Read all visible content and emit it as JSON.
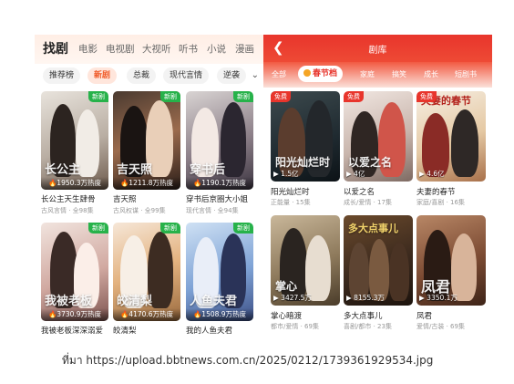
{
  "left_app": {
    "categories": [
      {
        "label": "找剧",
        "active": true
      },
      {
        "label": "电影"
      },
      {
        "label": "电视剧"
      },
      {
        "label": "大视听"
      },
      {
        "label": "听书"
      },
      {
        "label": "小说"
      },
      {
        "label": "漫画"
      }
    ],
    "filters": [
      {
        "label": "推荐榜"
      },
      {
        "label": "新剧",
        "active": true
      },
      {
        "label": "总裁"
      },
      {
        "label": "现代言情"
      },
      {
        "label": "逆袭"
      }
    ],
    "dramas": [
      {
        "title": "长公主天生肆骨",
        "meta": "古风言情 · 全98集",
        "heat": "1950.3万热度",
        "badge": "新剧",
        "calligraphy": "长公主"
      },
      {
        "title": "吉天照",
        "meta": "古风权谋 · 全99集",
        "heat": "1211.8万热度",
        "badge": "新剧",
        "calligraphy": "吉天照"
      },
      {
        "title": "穿书后京圈大小姐",
        "meta": "现代言情 · 全94集",
        "heat": "1190.1万热度",
        "badge": "新剧",
        "calligraphy": "穿书后"
      },
      {
        "title": "我被老板深深溺爱",
        "meta": "",
        "heat": "3730.9万热度",
        "badge": "新剧",
        "calligraphy": "我被老板"
      },
      {
        "title": "皎清梨",
        "meta": "",
        "heat": "4170.6万热度",
        "badge": "新剧",
        "calligraphy": "皎清梨"
      },
      {
        "title": "我的人鱼夫君",
        "meta": "",
        "heat": "1508.9万热度",
        "badge": "新剧",
        "calligraphy": "人鱼夫君"
      }
    ]
  },
  "right_app": {
    "title": "剧库",
    "back_icon": "chevron-left-icon",
    "tabs": [
      {
        "label": "全部"
      },
      {
        "label": "春节档",
        "active": true
      },
      {
        "label": "家庭"
      },
      {
        "label": "搞笑"
      },
      {
        "label": "成长"
      },
      {
        "label": "短剧书"
      }
    ],
    "dramas": [
      {
        "title": "阳光灿烂时",
        "meta": "正能量 · 15集",
        "plays": "1.5亿",
        "badge": "免费",
        "calligraphy": "阳光灿烂时"
      },
      {
        "title": "以爱之名",
        "meta": "成长/爱情 · 17集",
        "plays": "4亿",
        "badge": "免费",
        "calligraphy": "以爱之名"
      },
      {
        "title": "夫妻的春节",
        "meta": "家庭/喜剧 · 16集",
        "plays": "4.6亿",
        "badge": "免费",
        "calligraphy": "夫妻的春节"
      },
      {
        "title": "掌心暗渡",
        "meta": "都市/爱情 · 69集",
        "plays": "3427.5万",
        "badge": "",
        "calligraphy": "掌心"
      },
      {
        "title": "多大点事儿",
        "meta": "喜剧/都市 · 23集",
        "plays": "8155.3万",
        "badge": "",
        "calligraphy": "多大点事儿"
      },
      {
        "title": "凤君",
        "meta": "爱情/古装 · 69集",
        "plays": "3350.1万",
        "badge": "",
        "calligraphy": "凤君"
      }
    ]
  },
  "caption": "ที่มา https://upload.bbtnews.com.cn/2025/0212/1739361929534.jpg"
}
